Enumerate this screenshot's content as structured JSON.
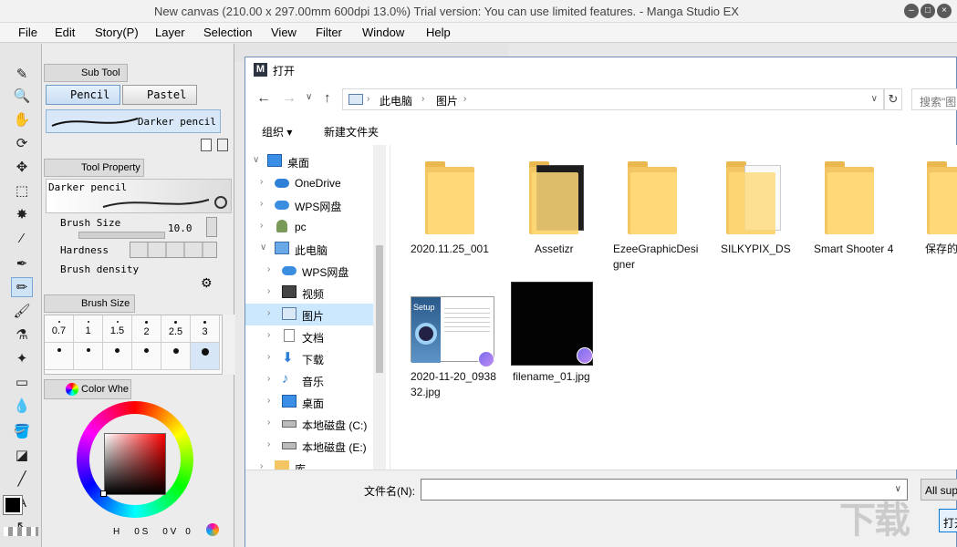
{
  "app": {
    "title": "New canvas (210.00 x 297.00mm 600dpi 13.0%)  Trial version: You can use limited features. - Manga Studio EX"
  },
  "menu": [
    "File",
    "Edit",
    "Story(P)",
    "Layer",
    "Selection",
    "View",
    "Filter",
    "Window",
    "Help"
  ],
  "left_panel": {
    "subtool_tab": "Sub Tool",
    "subtool_buttons": [
      "Pencil",
      "Pastel"
    ],
    "brush_preset": "Darker pencil",
    "tool_property_tab": "Tool Property",
    "property_preset": "Darker pencil",
    "brush_size_label": "Brush Size",
    "brush_size_value": "10.0",
    "hardness_label": "Hardness",
    "brush_density_label": "Brush density",
    "brush_size_tab": "Brush Size",
    "brush_sizes_row1": [
      "0.7",
      "1",
      "1.5",
      "2",
      "2.5",
      "3"
    ],
    "color_tab": "Color Whe",
    "color_readout": [
      "H",
      "0 S",
      "0 V",
      "0"
    ],
    "accent_color": "#cfe3f7"
  },
  "dialog": {
    "title": "打开",
    "breadcrumb": [
      "此电脑",
      "图片"
    ],
    "search_placeholder": "搜索\"图",
    "organize_label": "组织 ▾",
    "new_folder_label": "新建文件夹",
    "nav_items": [
      {
        "label": "桌面",
        "icon": "desktop-icon"
      },
      {
        "label": "OneDrive",
        "icon": "cloud-icon"
      },
      {
        "label": "WPS网盘",
        "icon": "cloud-icon"
      },
      {
        "label": "pc",
        "icon": "user-icon"
      },
      {
        "label": "此电脑",
        "icon": "computer-icon"
      },
      {
        "label": "WPS网盘",
        "icon": "cloud-icon"
      },
      {
        "label": "视频",
        "icon": "video-icon"
      },
      {
        "label": "图片",
        "icon": "pictures-icon"
      },
      {
        "label": "文档",
        "icon": "documents-icon"
      },
      {
        "label": "下载",
        "icon": "download-icon"
      },
      {
        "label": "音乐",
        "icon": "music-icon"
      },
      {
        "label": "桌面",
        "icon": "desktop-icon"
      },
      {
        "label": "本地磁盘 (C:)",
        "icon": "drive-icon"
      },
      {
        "label": "本地磁盘 (E:)",
        "icon": "drive-icon"
      },
      {
        "label": "库",
        "icon": "library-icon"
      }
    ],
    "files": [
      {
        "name": "2020.11.25_001",
        "type": "folder"
      },
      {
        "name": "Assetizr",
        "type": "folder"
      },
      {
        "name": "EzeeGraphicDesigner",
        "type": "folder"
      },
      {
        "name": "SILKYPIX_DS",
        "type": "folder"
      },
      {
        "name": "Smart Shooter 4",
        "type": "folder"
      },
      {
        "name": "保存的",
        "type": "folder"
      },
      {
        "name": "2020-11-20_093832.jpg",
        "type": "image"
      },
      {
        "name": "filename_01.jpg",
        "type": "image"
      }
    ],
    "setup_thumb_text": "Setup",
    "filename_label": "文件名(N):",
    "filename_value": "",
    "filetype_value": "All sup",
    "open_button": "打开"
  }
}
